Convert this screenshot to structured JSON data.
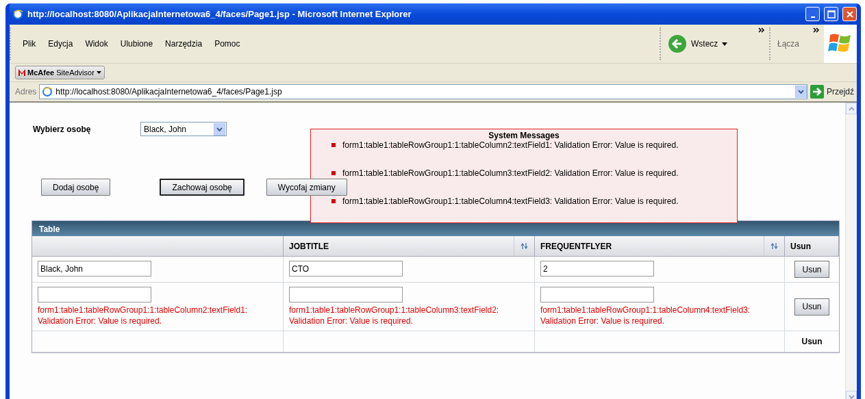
{
  "window": {
    "title": "http://localhost:8080/AplikacjaInternetowa6_4/faces/Page1.jsp - Microsoft Internet Explorer"
  },
  "menu": [
    "Plik",
    "Edycja",
    "Widok",
    "Ulubione",
    "Narzędzia",
    "Pomoc"
  ],
  "toolbar": {
    "back": "Wstecz",
    "links": "Łącza"
  },
  "addon": {
    "label": "**McAfee** SiteAdvisor"
  },
  "address": {
    "label": "Adres",
    "url": "http://localhost:8080/AplikacjaInternetowa6_4/faces/Page1.jsp",
    "go": "Przejdź"
  },
  "page": {
    "select_label": "Wybierz osobę",
    "select_value": "Black, John",
    "buttons": [
      {
        "label": "Dodaj osobę",
        "focused": false
      },
      {
        "label": "Zachowaj osobę",
        "focused": true
      },
      {
        "label": "Wycofaj zmiany",
        "focused": false
      }
    ],
    "system_messages": {
      "title": "System Messages",
      "items": [
        "form1:table1:tableRowGroup1:1:tableColumn2:textField1: Validation Error: Value is required.",
        "form1:table1:tableRowGroup1:1:tableColumn3:textField2: Validation Error: Value is required.",
        "form1:table1:tableRowGroup1:1:tableColumn4:textField3: Validation Error: Value is required."
      ]
    },
    "table": {
      "title": "Table",
      "columns": [
        {
          "sortable": false
        },
        {
          "label": "JOBTITLE",
          "sortable": true
        },
        {
          "label": "FREQUENTFLYER",
          "sortable": true
        },
        {
          "label": "Usun",
          "sortable": false
        }
      ],
      "rows": [
        {
          "cells": [
            {
              "value": "Black, John"
            },
            {
              "value": "CTO"
            },
            {
              "value": "2"
            }
          ],
          "action": "Usun"
        },
        {
          "cells": [
            {
              "error": "form1:table1:tableRowGroup1:1:tableColumn2:textField1: Validation Error: Value is required."
            },
            {
              "error": "form1:table1:tableRowGroup1:1:tableColumn3:textField2: Validation Error: Value is required."
            },
            {
              "error": "form1:table1:tableRowGroup1:1:tableColumn4:textField3: Validation Error: Value is required."
            }
          ],
          "action": "Usun"
        }
      ],
      "footer": "Usun"
    }
  }
}
